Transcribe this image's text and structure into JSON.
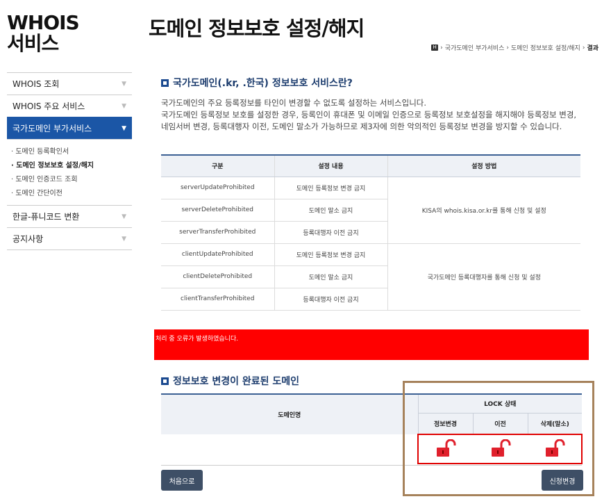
{
  "brand": {
    "line1": "WHOIS",
    "line2": "서비스"
  },
  "sidebar": {
    "items": [
      {
        "label": "WHOIS 조회"
      },
      {
        "label": "WHOIS 주요 서비스"
      },
      {
        "label": "국가도메인 부가서비스"
      }
    ],
    "sub_items": [
      {
        "label": "· 도메인 등록확인서"
      },
      {
        "label": "· 도메인 정보보호 설정/해지"
      },
      {
        "label": "· 도메인 인증코드 조회"
      },
      {
        "label": "· 도메인 간단이전"
      }
    ],
    "items_after": [
      {
        "label": "한글-퓨니코드 변환"
      },
      {
        "label": "공지사항"
      }
    ]
  },
  "page": {
    "title": "도메인 정보보호 설정/해지"
  },
  "breadcrumb": {
    "home": "H",
    "parts": [
      "국가도메인 부가서비스",
      "도메인 정보보호 설정/해지"
    ],
    "current": "결과"
  },
  "intro": {
    "heading": "국가도메인(.kr, .한국) 정보보호 서비스란?",
    "para1": "국가도메인의 주요 등록정보를 타인이 변경할 수 없도록 설정하는 서비스입니다.",
    "para2": "국가도메인 등록정보 보호를 설정한 경우, 등록인이 휴대폰 및 이메일 인증으로 등록정보 보호설정을 해지해야 등록정보 변경, 네임서버 변경, 등록대행자 이전, 도메인 말소가 가능하므로 제3자에 의한 악의적인 등록정보 변경을 방지할 수 있습니다."
  },
  "table1": {
    "headers": [
      "구분",
      "설정 내용",
      "설정 방법"
    ],
    "rows": [
      {
        "code": "serverUpdateProhibited",
        "content": "도메인 등록정보 변경 금지"
      },
      {
        "code": "serverDeleteProhibited",
        "content": "도메인 말소 금지"
      },
      {
        "code": "serverTransferProhibited",
        "content": "등록대행자 이전 금지"
      },
      {
        "code": "clientUpdateProhibited",
        "content": "도메인 등록정보 변경 금지"
      },
      {
        "code": "clientDeleteProhibited",
        "content": "도메인 말소 금지"
      },
      {
        "code": "clientTransferProhibited",
        "content": "등록대행자 이전 금지"
      }
    ],
    "method_server": "KISA의 whois.kisa.or.kr를 통해 신청 및 설정",
    "method_client": "국가도메인 등록대행자를 통해 신청 및 설정"
  },
  "error": {
    "message": "처리 중 오류가 발생하였습니다."
  },
  "result": {
    "heading": "정보보호 변경이 완료된 도메인",
    "col_domain": "도메인명",
    "col_lock": "LOCK 상태",
    "sub_cols": [
      "정보변경",
      "이전",
      "삭제(말소)"
    ],
    "domain_value": "",
    "lock_states": [
      "unlocked",
      "unlocked",
      "unlocked"
    ]
  },
  "buttons": {
    "first": "처음으로",
    "apply": "신청변경"
  },
  "colors": {
    "accent": "#1b56a6",
    "error": "#ff0000",
    "lock": "#e0202c"
  },
  "icons": {
    "section": "square-bullet-icon",
    "lock": "unlocked-padlock-icon",
    "chevron": "chevron-down-icon"
  }
}
